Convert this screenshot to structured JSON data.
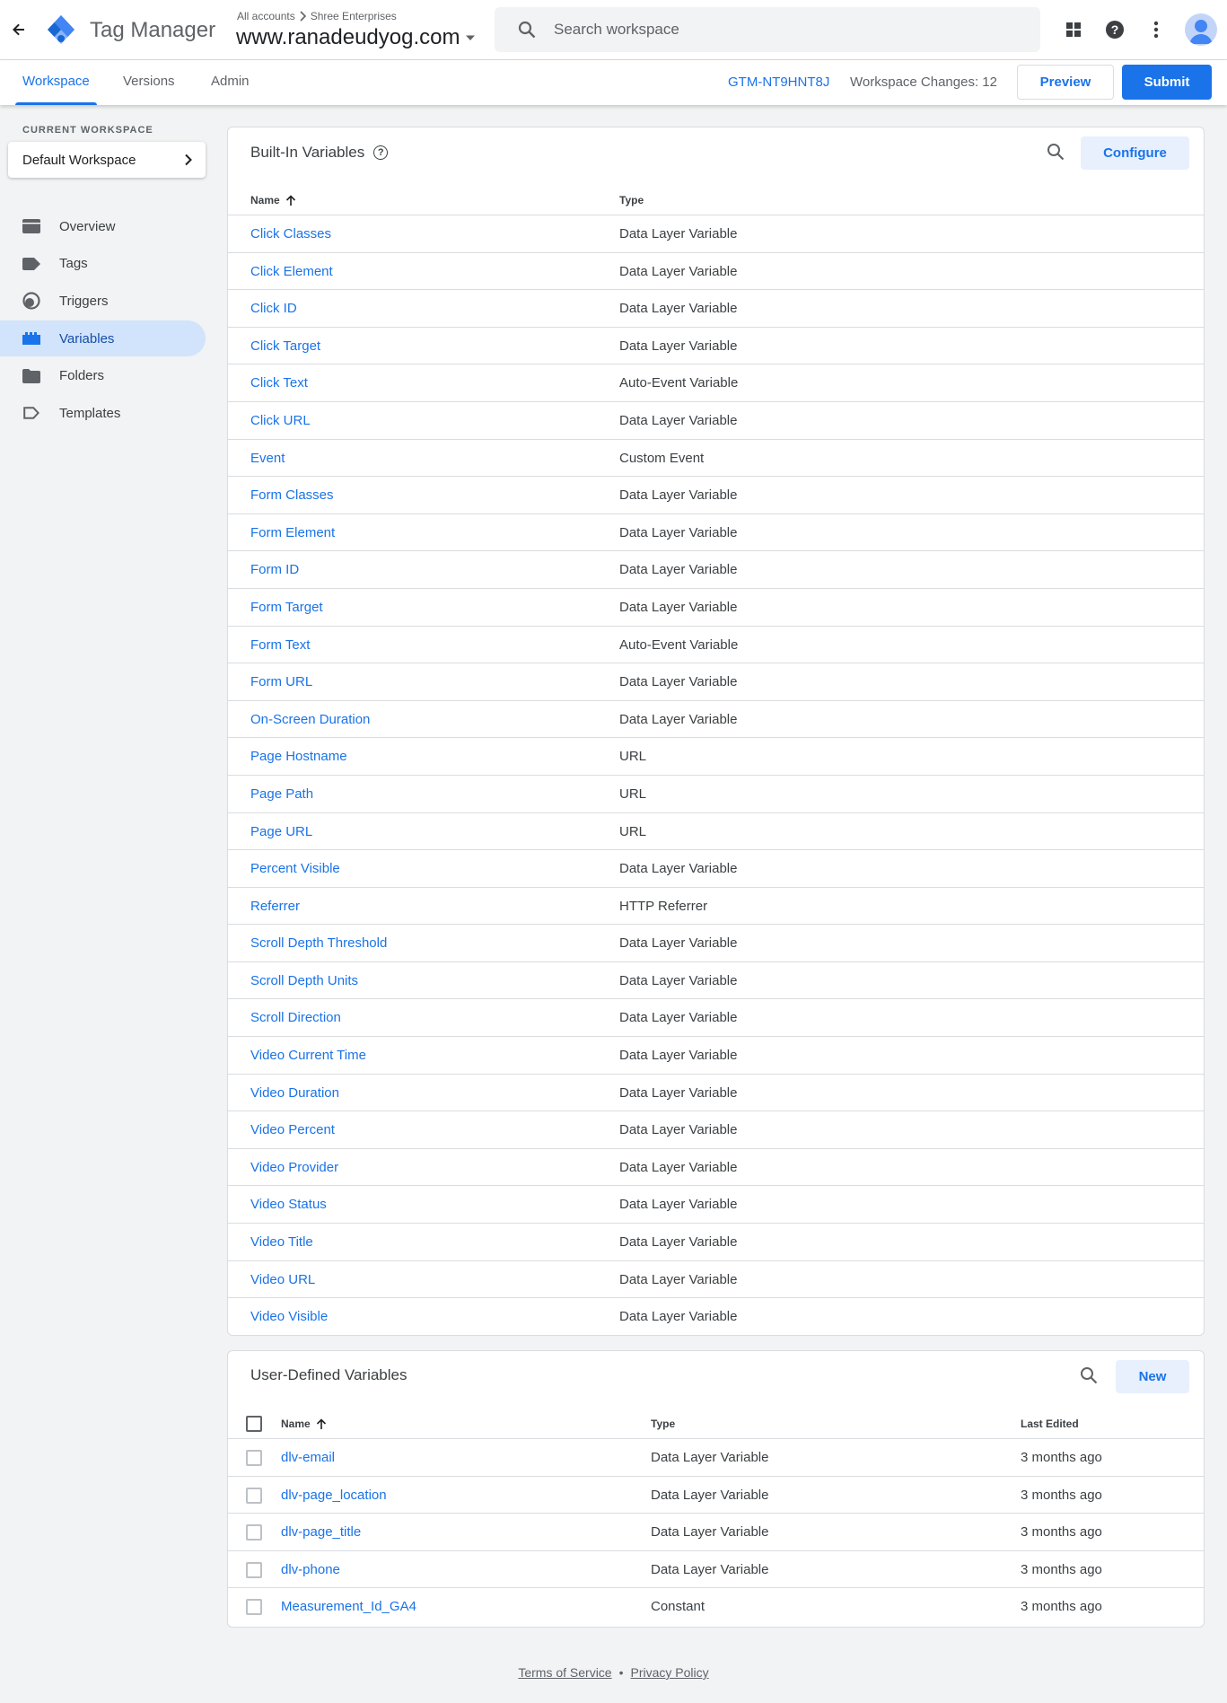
{
  "header": {
    "product_name": "Tag Manager",
    "breadcrumb_root": "All accounts",
    "breadcrumb_account": "Shree Enterprises",
    "container_name": "www.ranadeudyog.com",
    "search_placeholder": "Search workspace"
  },
  "nav": {
    "tabs": [
      {
        "label": "Workspace",
        "active": true
      },
      {
        "label": "Versions",
        "active": false
      },
      {
        "label": "Admin",
        "active": false
      }
    ],
    "container_id": "GTM-NT9HNT8J",
    "workspace_changes": "Workspace Changes: 12",
    "preview_label": "Preview",
    "submit_label": "Submit"
  },
  "sidebar": {
    "current_workspace_label": "CURRENT WORKSPACE",
    "workspace_name": "Default Workspace",
    "items": [
      {
        "label": "Overview",
        "icon": "overview-icon"
      },
      {
        "label": "Tags",
        "icon": "tag-icon"
      },
      {
        "label": "Triggers",
        "icon": "trigger-icon"
      },
      {
        "label": "Variables",
        "icon": "variables-icon",
        "active": true
      },
      {
        "label": "Folders",
        "icon": "folder-icon"
      },
      {
        "label": "Templates",
        "icon": "template-icon"
      }
    ]
  },
  "builtin": {
    "title": "Built-In Variables",
    "configure_label": "Configure",
    "col_name": "Name",
    "col_type": "Type",
    "rows": [
      {
        "name": "Click Classes",
        "type": "Data Layer Variable"
      },
      {
        "name": "Click Element",
        "type": "Data Layer Variable"
      },
      {
        "name": "Click ID",
        "type": "Data Layer Variable"
      },
      {
        "name": "Click Target",
        "type": "Data Layer Variable"
      },
      {
        "name": "Click Text",
        "type": "Auto-Event Variable"
      },
      {
        "name": "Click URL",
        "type": "Data Layer Variable"
      },
      {
        "name": "Event",
        "type": "Custom Event"
      },
      {
        "name": "Form Classes",
        "type": "Data Layer Variable"
      },
      {
        "name": "Form Element",
        "type": "Data Layer Variable"
      },
      {
        "name": "Form ID",
        "type": "Data Layer Variable"
      },
      {
        "name": "Form Target",
        "type": "Data Layer Variable"
      },
      {
        "name": "Form Text",
        "type": "Auto-Event Variable"
      },
      {
        "name": "Form URL",
        "type": "Data Layer Variable"
      },
      {
        "name": "On-Screen Duration",
        "type": "Data Layer Variable"
      },
      {
        "name": "Page Hostname",
        "type": "URL"
      },
      {
        "name": "Page Path",
        "type": "URL"
      },
      {
        "name": "Page URL",
        "type": "URL"
      },
      {
        "name": "Percent Visible",
        "type": "Data Layer Variable"
      },
      {
        "name": "Referrer",
        "type": "HTTP Referrer"
      },
      {
        "name": "Scroll Depth Threshold",
        "type": "Data Layer Variable"
      },
      {
        "name": "Scroll Depth Units",
        "type": "Data Layer Variable"
      },
      {
        "name": "Scroll Direction",
        "type": "Data Layer Variable"
      },
      {
        "name": "Video Current Time",
        "type": "Data Layer Variable"
      },
      {
        "name": "Video Duration",
        "type": "Data Layer Variable"
      },
      {
        "name": "Video Percent",
        "type": "Data Layer Variable"
      },
      {
        "name": "Video Provider",
        "type": "Data Layer Variable"
      },
      {
        "name": "Video Status",
        "type": "Data Layer Variable"
      },
      {
        "name": "Video Title",
        "type": "Data Layer Variable"
      },
      {
        "name": "Video URL",
        "type": "Data Layer Variable"
      },
      {
        "name": "Video Visible",
        "type": "Data Layer Variable"
      }
    ]
  },
  "userdefined": {
    "title": "User-Defined Variables",
    "new_label": "New",
    "col_name": "Name",
    "col_type": "Type",
    "col_edited": "Last Edited",
    "rows": [
      {
        "name": "dlv-email",
        "type": "Data Layer Variable",
        "edited": "3 months ago"
      },
      {
        "name": "dlv-page_location",
        "type": "Data Layer Variable",
        "edited": "3 months ago"
      },
      {
        "name": "dlv-page_title",
        "type": "Data Layer Variable",
        "edited": "3 months ago"
      },
      {
        "name": "dlv-phone",
        "type": "Data Layer Variable",
        "edited": "3 months ago"
      },
      {
        "name": "Measurement_Id_GA4",
        "type": "Constant",
        "edited": "3 months ago"
      }
    ]
  },
  "footer": {
    "terms": "Terms of Service",
    "separator": "•",
    "privacy": "Privacy Policy"
  },
  "colors": {
    "primary": "#1a73e8",
    "nav_active_bg": "#d2e3fc",
    "page_bg": "#f1f3f4"
  }
}
